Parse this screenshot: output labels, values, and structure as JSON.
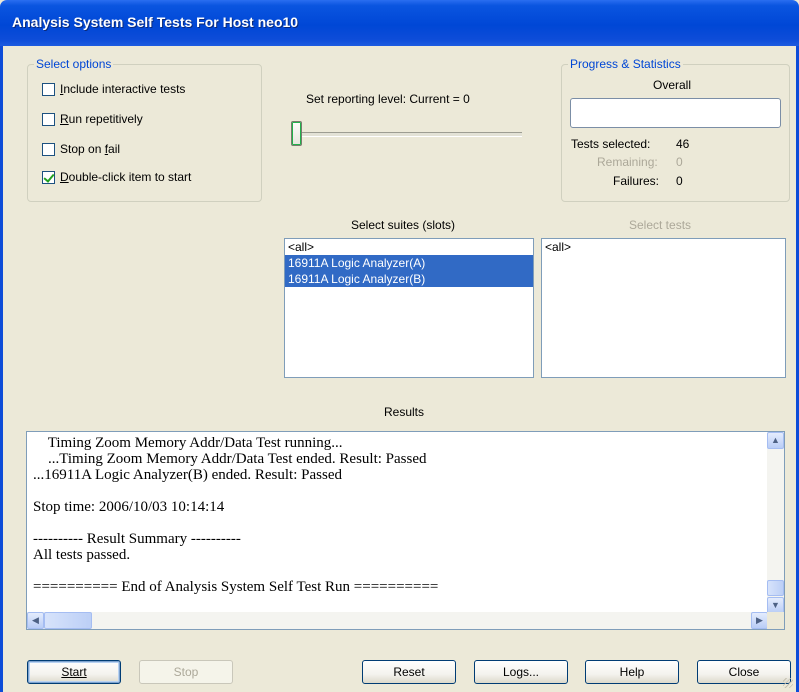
{
  "window": {
    "title": "Analysis System Self Tests For Host neo10"
  },
  "options": {
    "legend": "Select options",
    "items": [
      {
        "label": "Include interactive tests",
        "checked": false
      },
      {
        "label": "Run repetitively",
        "checked": false
      },
      {
        "label": "Stop on fail",
        "checked": false
      },
      {
        "label": "Double-click item to start",
        "checked": true
      }
    ]
  },
  "reporting": {
    "label": "Set reporting level: Current = 0",
    "value": 0
  },
  "progress": {
    "legend": "Progress & Statistics",
    "overall_label": "Overall",
    "overall_fraction": 0,
    "tests_selected_label": "Tests selected:",
    "tests_selected": "46",
    "remaining_label": "Remaining:",
    "remaining": "0",
    "failures_label": "Failures:",
    "failures": "0"
  },
  "suites": {
    "label": "Select suites (slots)",
    "items": [
      "<all>",
      "16911A Logic Analyzer(A)",
      "16911A Logic Analyzer(B)"
    ]
  },
  "tests": {
    "label": "Select tests",
    "items": [
      "<all>"
    ]
  },
  "results": {
    "label": "Results",
    "lines": [
      "    Timing Zoom Memory Addr/Data Test running...",
      "    ...Timing Zoom Memory Addr/Data Test ended. Result: Passed",
      "...16911A Logic Analyzer(B) ended. Result: Passed",
      "",
      "Stop time: 2006/10/03 10:14:14",
      "",
      "---------- Result Summary ----------",
      "All tests passed.",
      "",
      "========== End of Analysis System Self Test Run =========="
    ]
  },
  "buttons": {
    "start": "Start",
    "stop": "Stop",
    "reset": "Reset",
    "logs": "Logs...",
    "help": "Help",
    "close": "Close"
  }
}
